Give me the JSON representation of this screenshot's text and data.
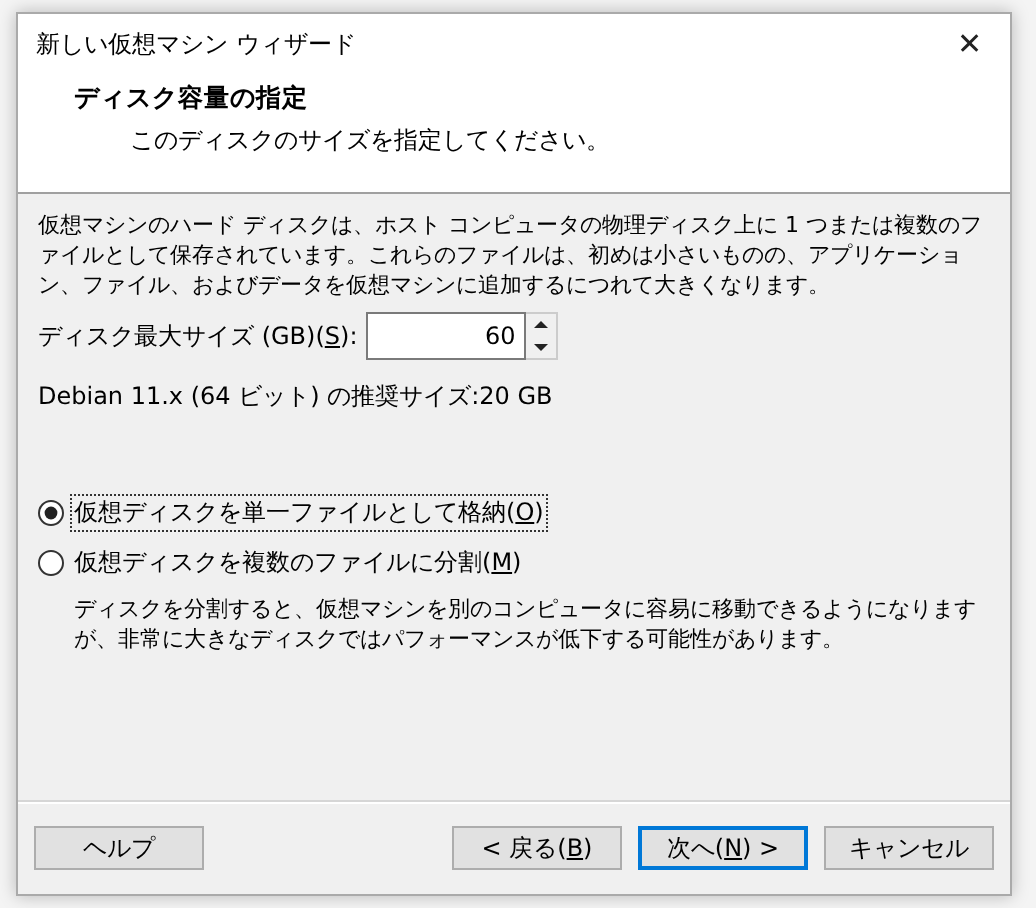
{
  "window": {
    "title": "新しい仮想マシン ウィザード",
    "close": "✕"
  },
  "header": {
    "title": "ディスク容量の指定",
    "subtitle": "このディスクのサイズを指定してください。"
  },
  "description": "仮想マシンのハード ディスクは、ホスト コンピュータの物理ディスク上に 1 つまたは複数のファイルとして保存されています。これらのファイルは、初めは小さいものの、アプリケーション、ファイル、およびデータを仮想マシンに追加するにつれて大きくなります。",
  "size_field": {
    "label_before": "ディスク最大サイズ (GB)(",
    "access_key": "S",
    "label_after": "):",
    "value": "60"
  },
  "recommended": "Debian 11.x (64 ビット) の推奨サイズ:20 GB",
  "radios": [
    {
      "label_before": "仮想ディスクを単一ファイルとして格納(",
      "access_key": "O",
      "label_after": ")",
      "selected": true,
      "focused": true
    },
    {
      "label_before": "仮想ディスクを複数のファイルに分割(",
      "access_key": "M",
      "label_after": ")",
      "selected": false,
      "focused": false
    }
  ],
  "split_note": "ディスクを分割すると、仮想マシンを別のコンピュータに容易に移動できるようになりますが、非常に大きなディスクではパフォーマンスが低下する可能性があります。",
  "buttons": [
    {
      "kind": "help",
      "label_before": "ヘルプ",
      "default": false
    },
    {
      "kind": "back",
      "label_before": "< 戻る(",
      "access_key": "B",
      "label_after": ")",
      "default": false
    },
    {
      "kind": "next",
      "label_before": "次へ(",
      "access_key": "N",
      "label_after": ") >",
      "default": true
    },
    {
      "kind": "cancel",
      "label_before": "キャンセル",
      "default": false
    }
  ]
}
